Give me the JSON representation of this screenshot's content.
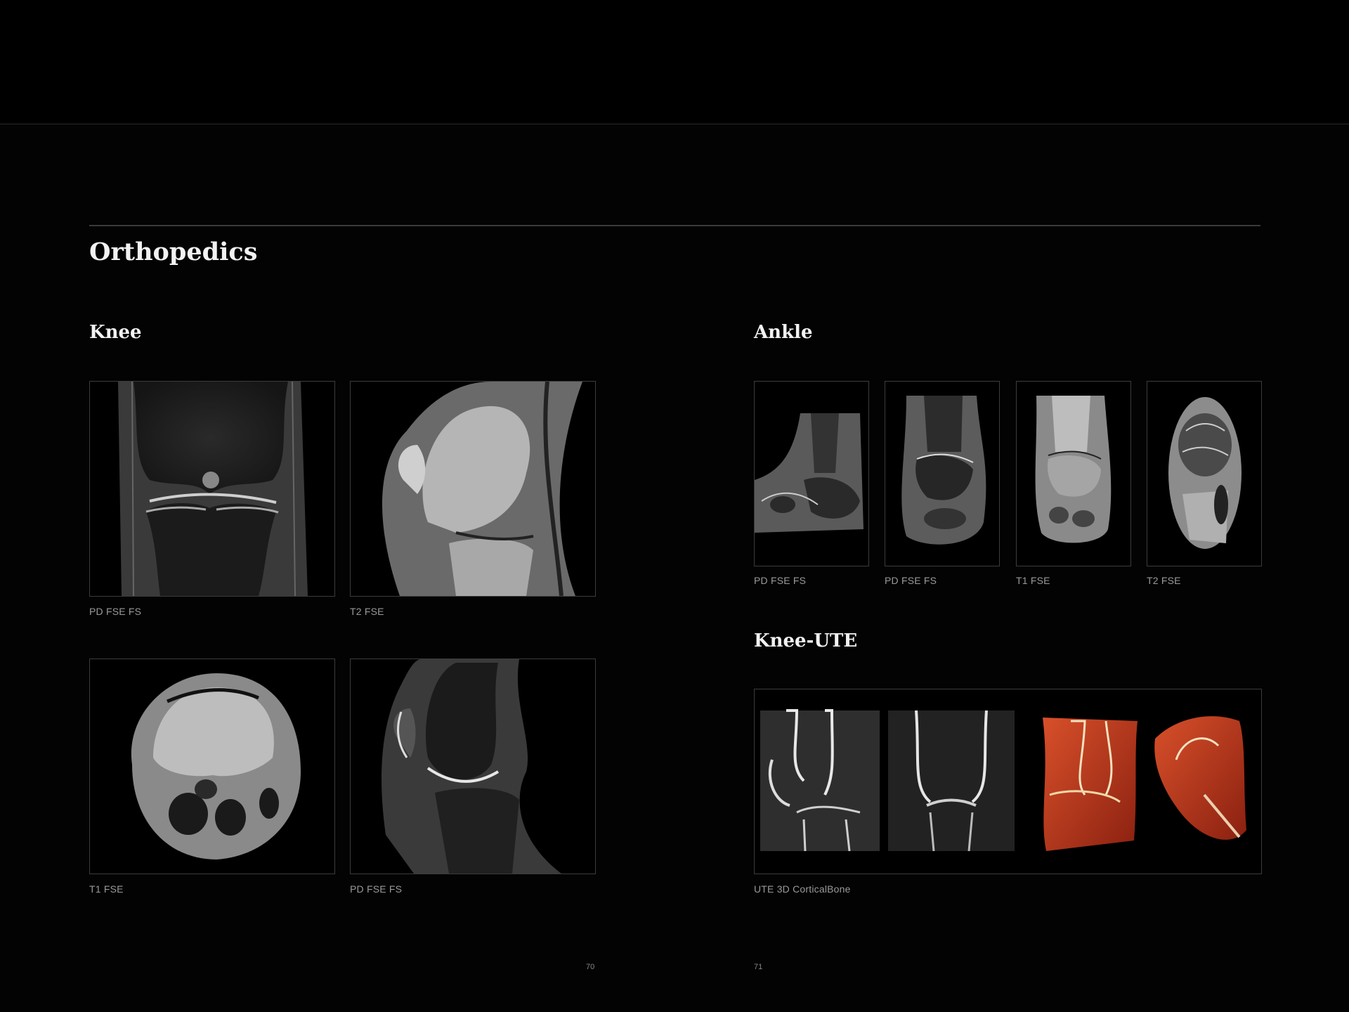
{
  "document": {
    "title": "Orthopedics",
    "sections": {
      "knee": {
        "heading": "Knee",
        "images": [
          {
            "caption": "PD FSE FS",
            "subject": "knee-coronal-mri"
          },
          {
            "caption": "T2 FSE",
            "subject": "knee-sagittal-mri"
          },
          {
            "caption": "T1 FSE",
            "subject": "knee-axial-mri"
          },
          {
            "caption": "PD FSE FS",
            "subject": "knee-sagittal-fs-mri"
          }
        ]
      },
      "ankle": {
        "heading": "Ankle",
        "images": [
          {
            "caption": "PD FSE FS",
            "subject": "ankle-sagittal-mri"
          },
          {
            "caption": "PD FSE FS",
            "subject": "ankle-coronal-mri"
          },
          {
            "caption": "T1 FSE",
            "subject": "ankle-coronal-t1-mri"
          },
          {
            "caption": "T2 FSE",
            "subject": "ankle-axial-mri"
          }
        ]
      },
      "knee_ute": {
        "heading": "Knee-UTE",
        "image": {
          "caption": "UTE 3D CorticalBone",
          "subject": "knee-ute-cortical-bone-composite"
        }
      }
    },
    "page_numbers": {
      "left": "70",
      "right": "71"
    }
  }
}
